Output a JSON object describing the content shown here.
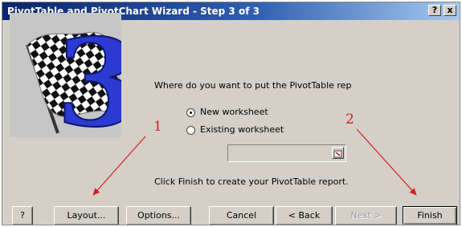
{
  "window": {
    "title": "PivotTable and PivotChart Wizard - Step 3 of 3",
    "help_btn": "?",
    "close_btn": "x"
  },
  "illustration": {
    "step_number": "3",
    "icon": "checkered-flag-icon"
  },
  "question": "Where do you want to put the PivotTable rep",
  "options": [
    {
      "label": "New worksheet",
      "selected": true
    },
    {
      "label": "Existing worksheet",
      "selected": false
    }
  ],
  "reference_input": {
    "value": "",
    "icon": "collapse-dialog-icon"
  },
  "hint": "Click Finish to create your PivotTable report.",
  "buttons": {
    "help": "?",
    "layout": "Layout...",
    "options": "Options...",
    "cancel": "Cancel",
    "back": "< Back",
    "next": "Next >",
    "finish": "Finish"
  },
  "annotations": {
    "one": "1",
    "two": "2",
    "color": "#d61e1e"
  }
}
